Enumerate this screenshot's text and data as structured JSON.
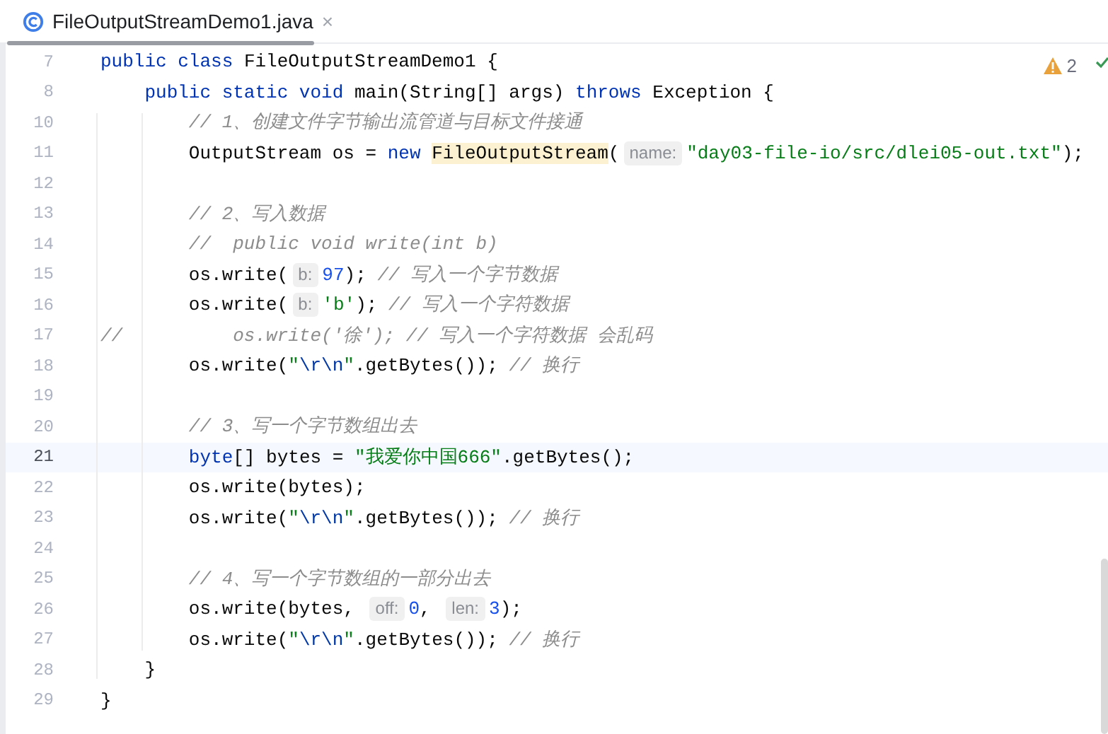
{
  "tab": {
    "title": "FileOutputStreamDemo1.java",
    "close": "×",
    "selected": true
  },
  "inspections": {
    "warnings": "2"
  },
  "lines": [
    {
      "number": "7",
      "current": false,
      "tokens": [
        {
          "kind": "keyword",
          "t": "public class"
        },
        {
          "kind": "plain",
          "t": " FileOutputStreamDemo1 {"
        }
      ]
    },
    {
      "number": "8",
      "current": false,
      "tokens": [
        {
          "kind": "keyword",
          "t": "    public static void"
        },
        {
          "kind": "plain",
          "t": " main(String[] args) "
        },
        {
          "kind": "keyword",
          "t": "throws"
        },
        {
          "kind": "plain",
          "t": " Exception {"
        }
      ]
    },
    {
      "number": "10",
      "current": false,
      "tokens": [
        {
          "kind": "comment",
          "t": "        // 1、创建文件字节输出流管道与目标文件接通"
        }
      ]
    },
    {
      "number": "11",
      "current": false,
      "tokens": [
        {
          "kind": "plain",
          "t": "        OutputStream os = "
        },
        {
          "kind": "keyword",
          "t": "new "
        },
        {
          "kind": "highlight",
          "t": "FileOutputStream"
        },
        {
          "kind": "plain",
          "t": "("
        },
        {
          "kind": "hint",
          "t": "name:"
        },
        {
          "kind": "string",
          "t": "\"day03-file-io/src/dlei05-out.txt\""
        },
        {
          "kind": "plain",
          "t": ");"
        }
      ]
    },
    {
      "number": "12",
      "current": false
    },
    {
      "number": "13",
      "current": false,
      "tokens": [
        {
          "kind": "comment",
          "t": "        // 2、写入数据"
        }
      ]
    },
    {
      "number": "14",
      "current": false,
      "tokens": [
        {
          "kind": "comment",
          "t": "        //  public void write(int b)"
        }
      ]
    },
    {
      "number": "15",
      "current": false,
      "tokens": [
        {
          "kind": "plain",
          "t": "        os.write("
        },
        {
          "kind": "hint",
          "t": "b:"
        },
        {
          "kind": "number",
          "t": "97"
        },
        {
          "kind": "plain",
          "t": "); "
        },
        {
          "kind": "comment",
          "t": "// 写入一个字节数据"
        }
      ]
    },
    {
      "number": "16",
      "current": false,
      "tokens": [
        {
          "kind": "plain",
          "t": "        os.write("
        },
        {
          "kind": "hint",
          "t": "b:"
        },
        {
          "kind": "string",
          "t": "'b'"
        },
        {
          "kind": "plain",
          "t": "); "
        },
        {
          "kind": "comment",
          "t": "// 写入一个字符数据"
        }
      ]
    },
    {
      "number": "17",
      "current": false,
      "tokens": [
        {
          "kind": "comment",
          "t": "//"
        },
        {
          "kind": "comment",
          "t": "          os.write('徐'); // 写入一个字符数据 会乱码"
        }
      ]
    },
    {
      "number": "18",
      "current": false,
      "tokens": [
        {
          "kind": "plain",
          "t": "        os.write("
        },
        {
          "kind": "string",
          "t": "\""
        },
        {
          "kind": "escape",
          "t": "\\r\\n"
        },
        {
          "kind": "string",
          "t": "\""
        },
        {
          "kind": "plain",
          "t": ".getBytes()); "
        },
        {
          "kind": "comment",
          "t": "// 换行"
        }
      ]
    },
    {
      "number": "19",
      "current": false
    },
    {
      "number": "20",
      "current": false,
      "tokens": [
        {
          "kind": "comment",
          "t": "        // 3、写一个字节数组出去"
        }
      ]
    },
    {
      "number": "21",
      "current": true,
      "tokens": [
        {
          "kind": "keyword",
          "t": "        byte"
        },
        {
          "kind": "plain",
          "t": "[] bytes = "
        },
        {
          "kind": "string",
          "t": "\"我爱你中国666\""
        },
        {
          "kind": "plain",
          "t": ".getBytes();"
        }
      ]
    },
    {
      "number": "22",
      "current": false,
      "tokens": [
        {
          "kind": "plain",
          "t": "        os.write(bytes);"
        }
      ]
    },
    {
      "number": "23",
      "current": false,
      "tokens": [
        {
          "kind": "plain",
          "t": "        os.write("
        },
        {
          "kind": "string",
          "t": "\""
        },
        {
          "kind": "escape",
          "t": "\\r\\n"
        },
        {
          "kind": "string",
          "t": "\""
        },
        {
          "kind": "plain",
          "t": ".getBytes()); "
        },
        {
          "kind": "comment",
          "t": "// 换行"
        }
      ]
    },
    {
      "number": "24",
      "current": false
    },
    {
      "number": "25",
      "current": false,
      "tokens": [
        {
          "kind": "comment",
          "t": "        // 4、写一个字节数组的一部分出去"
        }
      ]
    },
    {
      "number": "26",
      "current": false,
      "tokens": [
        {
          "kind": "plain",
          "t": "        os.write(bytes, "
        },
        {
          "kind": "hint",
          "t": "off:"
        },
        {
          "kind": "number",
          "t": "0"
        },
        {
          "kind": "plain",
          "t": ", "
        },
        {
          "kind": "hint",
          "t": "len:"
        },
        {
          "kind": "number",
          "t": "3"
        },
        {
          "kind": "plain",
          "t": ");"
        }
      ]
    },
    {
      "number": "27",
      "current": false,
      "tokens": [
        {
          "kind": "plain",
          "t": "        os.write("
        },
        {
          "kind": "string",
          "t": "\""
        },
        {
          "kind": "escape",
          "t": "\\r\\n"
        },
        {
          "kind": "string",
          "t": "\""
        },
        {
          "kind": "plain",
          "t": ".getBytes()); "
        },
        {
          "kind": "comment",
          "t": "// 换行"
        }
      ]
    },
    {
      "number": "28",
      "current": false,
      "tokens": [
        {
          "kind": "plain",
          "t": "    }"
        }
      ]
    },
    {
      "number": "29",
      "current": false,
      "tokens": [
        {
          "kind": "plain",
          "t": "}"
        }
      ]
    }
  ]
}
